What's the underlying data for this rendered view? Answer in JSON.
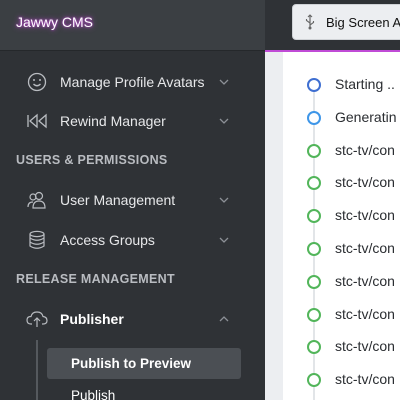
{
  "app": {
    "brand": "Jawwy CMS",
    "accent_color": "#c04bd6"
  },
  "sidebar": {
    "items_top": [
      {
        "label": "Manage Profile Avatars",
        "icon": "smiley-icon"
      },
      {
        "label": "Rewind Manager",
        "icon": "rewind-icon"
      }
    ],
    "sections": [
      {
        "title": "USERS & PERMISSIONS",
        "items": [
          {
            "label": "User Management",
            "icon": "users-icon"
          },
          {
            "label": "Access Groups",
            "icon": "database-icon"
          }
        ]
      },
      {
        "title": "RELEASE MANAGEMENT",
        "items": [
          {
            "label": "Publisher",
            "icon": "cloud-upload-icon",
            "expanded": true
          }
        ],
        "subitems": [
          {
            "label": "Publish to Preview",
            "active": true
          },
          {
            "label": "Publish"
          }
        ]
      }
    ]
  },
  "topbar": {
    "device_label": "Big Screen A",
    "device_icon": "usb-icon"
  },
  "log": {
    "entries": [
      {
        "text": "Starting ..",
        "status": "start",
        "color": "#3f6fd1"
      },
      {
        "text": "Generatin",
        "status": "running",
        "color": "#3e96e8"
      },
      {
        "text": "stc-tv/con",
        "status": "done",
        "color": "#52b55a"
      },
      {
        "text": "stc-tv/con",
        "status": "done",
        "color": "#52b55a"
      },
      {
        "text": "stc-tv/con",
        "status": "done",
        "color": "#52b55a"
      },
      {
        "text": "stc-tv/con",
        "status": "done",
        "color": "#52b55a"
      },
      {
        "text": "stc-tv/con",
        "status": "done",
        "color": "#52b55a"
      },
      {
        "text": "stc-tv/con",
        "status": "done",
        "color": "#52b55a"
      },
      {
        "text": "stc-tv/con",
        "status": "done",
        "color": "#52b55a"
      },
      {
        "text": "stc-tv/con",
        "status": "done",
        "color": "#52b55a"
      }
    ]
  }
}
